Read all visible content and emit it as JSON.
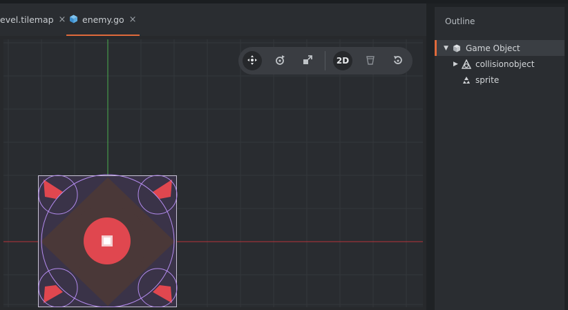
{
  "tabs": [
    {
      "label": "evel.tilemap",
      "close": "×"
    },
    {
      "label": "enemy.go",
      "close": "×",
      "active": true
    }
  ],
  "toolbar": {
    "tools": [
      {
        "name": "move-tool",
        "icon": "move-icon",
        "active": true
      },
      {
        "name": "rotate-tool",
        "icon": "rotate-icon"
      },
      {
        "name": "scale-tool",
        "icon": "scale-icon"
      },
      {
        "name": "2d-mode-toggle",
        "label": "2D"
      },
      {
        "name": "visibility-filter",
        "icon": "filter-icon"
      },
      {
        "name": "camera-reset",
        "icon": "refresh-icon"
      }
    ]
  },
  "outline": {
    "title": "Outline",
    "items": [
      {
        "label": "Game Object",
        "icon": "cube-icon",
        "expanded": true,
        "selected": true,
        "depth": 0
      },
      {
        "label": "collisionobject",
        "icon": "collision-icon",
        "expanded": false,
        "depth": 1
      },
      {
        "label": "sprite",
        "icon": "sprite-icon",
        "depth": 1
      }
    ]
  },
  "colors": {
    "accent": "#e06a3b",
    "axis_y": "#4caf50",
    "axis_x": "#c0392b",
    "collision_outline": "#b58cf0",
    "sprite_red": "#e0474f",
    "sprite_brown": "#4a3838"
  }
}
